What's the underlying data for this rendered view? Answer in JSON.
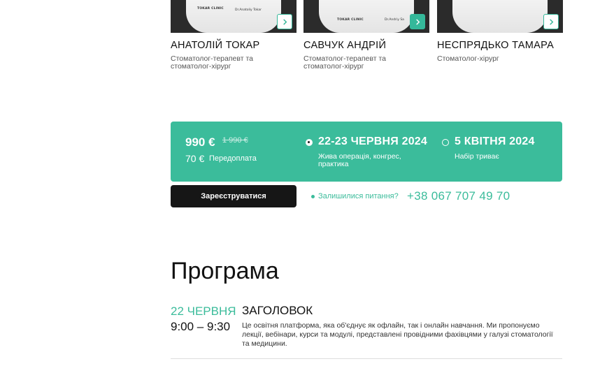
{
  "speakers": [
    {
      "name": "АНАТОЛІЙ ТОКАР",
      "role": "Стоматолог-терапевт та стоматолог-хірург",
      "shirt_logo": "TOKAR CLINIC",
      "shirt_tag": "Dr.Anatoliy Tokar",
      "button_icon": "chevron-right-icon",
      "button_style": "outline"
    },
    {
      "name": "САВЧУК АНДРІЙ",
      "role": "Стоматолог-терапевт та стоматолог-хірург",
      "shirt_logo": "TOKAR CLINIC",
      "shirt_tag": "Dr.Andriy Sa",
      "button_icon": "chevron-right-icon",
      "button_style": "filled"
    },
    {
      "name": "НЕСПРЯДЬКО ТАМАРА",
      "role": "Стоматолог-хірург",
      "shirt_logo": "",
      "shirt_tag": "",
      "button_icon": "chevron-right-icon",
      "button_style": "outline"
    }
  ],
  "pricing": {
    "price": "990 €",
    "old_price": "1 990 €",
    "prepayment_amount": "70 €",
    "prepayment_label": "Передоплата",
    "options": [
      {
        "title": "22-23 ЧЕРВНЯ 2024",
        "subtitle": "Жива операція, конгрес, практика",
        "selected": true
      },
      {
        "title": "5 КВІТНЯ 2024",
        "subtitle": "Набір триває",
        "selected": false
      }
    ]
  },
  "cta": {
    "register_label": "Зареєструватися",
    "question_label": "Залишилися питання?",
    "phone": "+38 067 707 49 70"
  },
  "program": {
    "title": "Програма",
    "items": [
      {
        "date": "22 ЧЕРВНЯ",
        "time": "9:00 – 9:30",
        "heading": "ЗАГОЛОВОК",
        "description": "Це освітня платформа, яка об'єднує як офлайн, так і онлайн навчання. Ми пропонуємо лекції, вебінари, курси та модулі, представлені провідними фахівцями у галузі стоматології та медицини."
      }
    ]
  },
  "colors": {
    "accent": "#3bbc9b",
    "button_dark": "#161616",
    "text": "#111111"
  }
}
